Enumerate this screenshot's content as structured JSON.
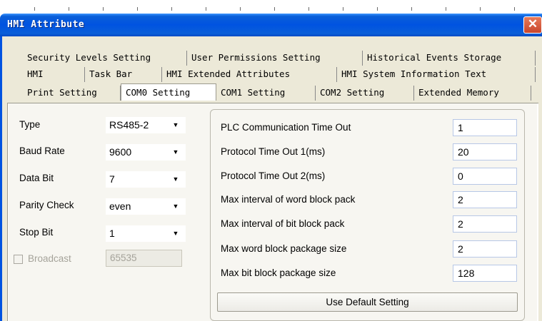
{
  "window": {
    "title": "HMI Attribute",
    "close": "✕"
  },
  "tabs": {
    "row1": [
      "Security Levels Setting",
      "User Permissions Setting",
      "Historical Events Storage"
    ],
    "row2": [
      "HMI",
      "Task Bar",
      "HMI Extended Attributes",
      "HMI System Information Text"
    ],
    "row3": [
      "Print Setting",
      "COM0 Setting",
      "COM1 Setting",
      "COM2 Setting",
      "Extended Memory"
    ],
    "active": "COM0 Setting"
  },
  "settings": {
    "type": {
      "label": "Type",
      "value": "RS485-2"
    },
    "baud": {
      "label": "Baud Rate",
      "value": "9600"
    },
    "databit": {
      "label": "Data Bit",
      "value": "7"
    },
    "parity": {
      "label": "Parity Check",
      "value": "even"
    },
    "stopbit": {
      "label": "Stop Bit",
      "value": "1"
    },
    "broadcast": {
      "label": "Broadcast",
      "value": "65535",
      "checked": false
    }
  },
  "protocol": {
    "plc_timeout": {
      "label": "PLC Communication Time Out",
      "value": "1"
    },
    "timeout1": {
      "label": "Protocol Time Out 1(ms)",
      "value": "20"
    },
    "timeout2": {
      "label": "Protocol Time Out 2(ms)",
      "value": "0"
    },
    "word_interval": {
      "label": "Max interval of word block pack",
      "value": "2"
    },
    "bit_interval": {
      "label": "Max interval of bit block pack",
      "value": "2"
    },
    "word_size": {
      "label": "Max word block package size",
      "value": "2"
    },
    "bit_size": {
      "label": "Max bit block package size",
      "value": "128"
    }
  },
  "buttons": {
    "default": "Use Default Setting"
  },
  "colors": {
    "titlebar": "#0053e1",
    "dialog": "#ece9d8",
    "close": "#c9462c"
  }
}
